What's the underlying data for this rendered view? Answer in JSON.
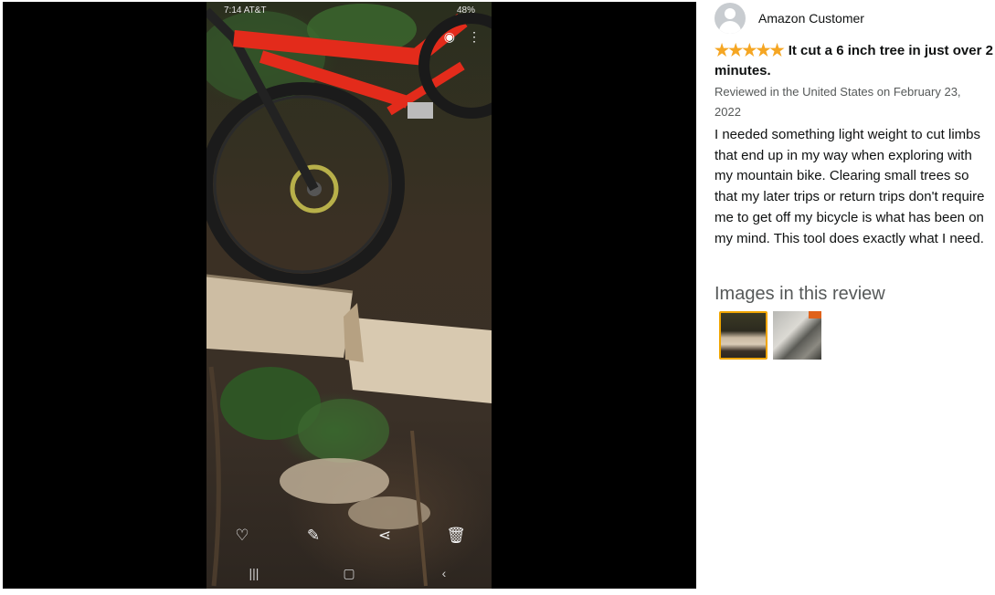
{
  "photo": {
    "status_time": "7:14 AT&T",
    "status_battery": "48%",
    "icons": [
      "eye-icon",
      "more-icon",
      "heart-icon",
      "edit-icon",
      "share-icon",
      "trash-icon"
    ]
  },
  "review": {
    "reviewer_name": "Amazon Customer",
    "stars": "★★★★★",
    "rating": 5,
    "title": "It cut a 6 inch tree in just over 2 minutes.",
    "date": "Reviewed in the United States on February 23, 2022",
    "body": "I needed something light weight to cut limbs that end up in my way when exploring with my mountain bike. Clearing small trees so that my later trips or return trips don't require me to get off my bicycle is what has been on my mind. This tool does exactly what I need."
  },
  "images_section": {
    "heading": "Images in this review"
  },
  "colors": {
    "star": "#f5a623",
    "thumb_selected_border": "#f0a500",
    "viewer_bg": "#000000"
  }
}
